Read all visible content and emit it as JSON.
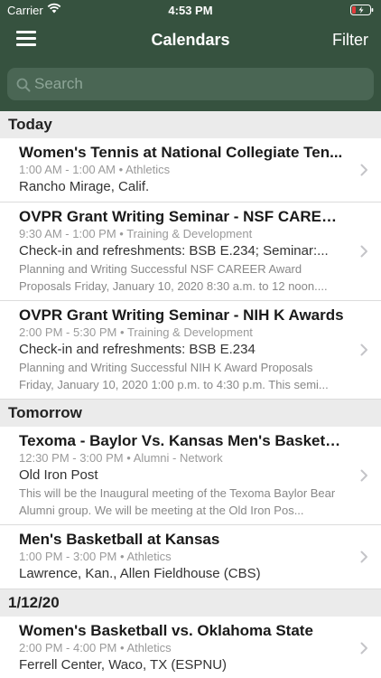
{
  "status_bar": {
    "carrier": "Carrier",
    "time": "4:53 PM"
  },
  "nav": {
    "title": "Calendars",
    "filter_label": "Filter"
  },
  "search": {
    "placeholder": "Search",
    "value": ""
  },
  "sections": [
    {
      "header": "Today",
      "events": [
        {
          "title": "Women's Tennis at National Collegiate Ten...",
          "time": "1:00 AM - 1:00 AM",
          "category": "Athletics",
          "location": "Rancho Mirage, Calif.",
          "description": ""
        },
        {
          "title": "OVPR Grant Writing Seminar - NSF CAREER...",
          "time": "9:30 AM - 1:00 PM",
          "category": "Training & Development",
          "location": "Check-in and refreshments: BSB E.234; Seminar:...",
          "description": "Planning and Writing Successful NSF CAREER Award Proposals Friday, January 10, 2020 8:30 a.m. to 12 noon...."
        },
        {
          "title": "OVPR Grant Writing Seminar - NIH K Awards",
          "time": "2:00 PM - 5:30 PM",
          "category": "Training & Development",
          "location": "Check-in and refreshments: BSB E.234",
          "description": "Planning and Writing Successful NIH K Award Proposals Friday, January 10, 2020 1:00 p.m. to 4:30 p.m. This semi..."
        }
      ]
    },
    {
      "header": "Tomorrow",
      "events": [
        {
          "title": "Texoma - Baylor Vs. Kansas Men's Basketb...",
          "time": "12:30 PM - 3:00 PM",
          "category": "Alumni - Network",
          "location": "Old Iron Post",
          "description": "This will be the Inaugural meeting of the Texoma Baylor Bear Alumni group. We will be meeting at the Old Iron Pos..."
        },
        {
          "title": "Men's Basketball at Kansas",
          "time": "1:00 PM - 3:00 PM",
          "category": "Athletics",
          "location": "Lawrence, Kan., Allen Fieldhouse (CBS)",
          "description": ""
        }
      ]
    },
    {
      "header": "1/12/20",
      "events": [
        {
          "title": "Women's Basketball vs. Oklahoma State",
          "time": "2:00 PM - 4:00 PM",
          "category": "Athletics",
          "location": "Ferrell Center, Waco, TX (ESPNU)",
          "description": ""
        }
      ]
    }
  ],
  "colors": {
    "header_bg": "#36523f",
    "search_bg": "#4a6654",
    "section_bg": "#ebebeb",
    "battery_low": "#e23b3b"
  },
  "icons": {
    "menu": "hamburger-icon",
    "search": "search-icon",
    "chevron": "chevron-right-icon",
    "wifi": "wifi-icon",
    "battery": "battery-icon"
  }
}
